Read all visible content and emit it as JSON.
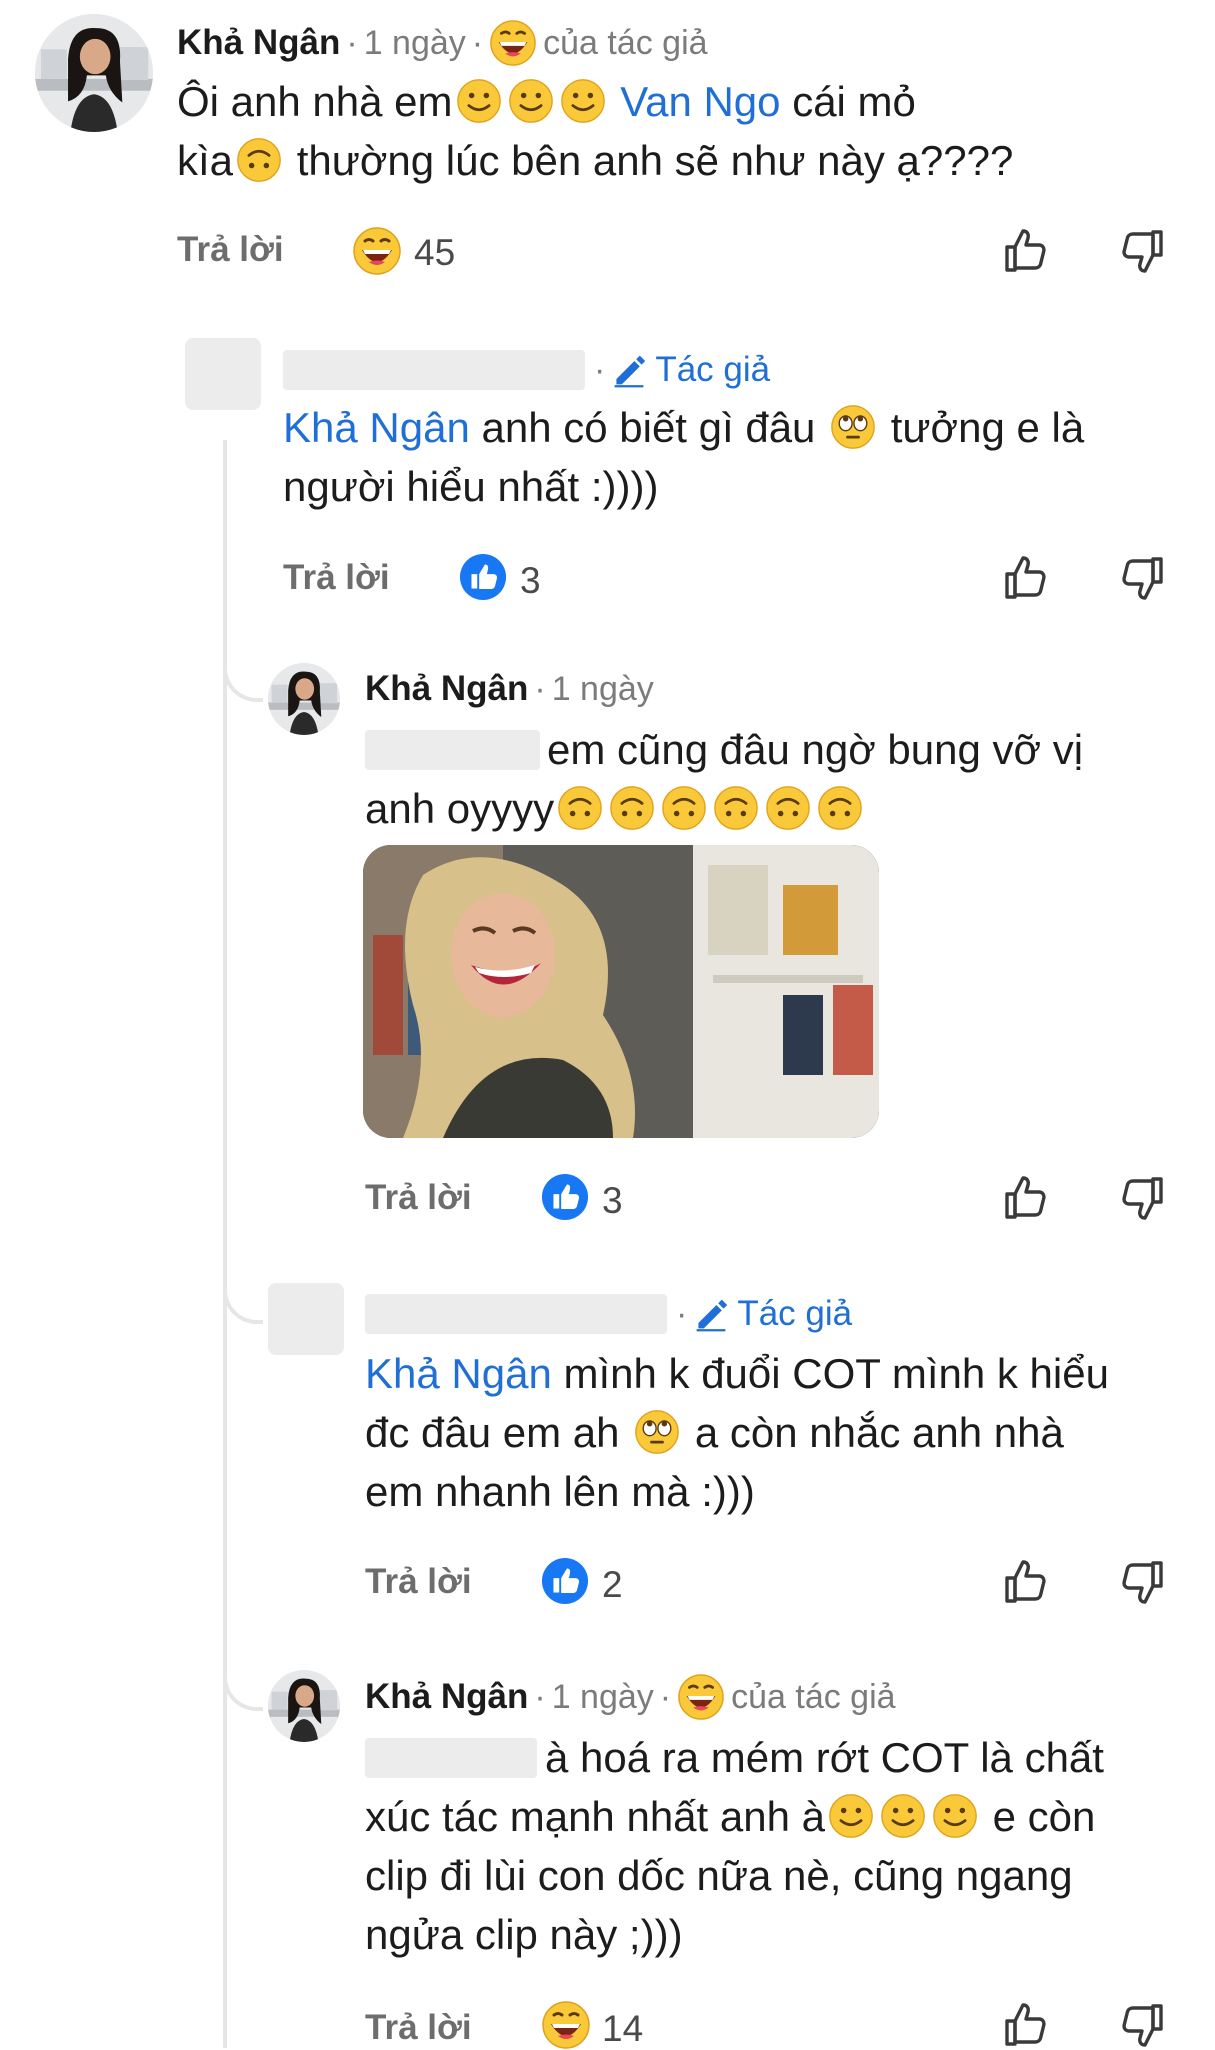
{
  "comments": [
    {
      "author": "Khả Ngân",
      "time": "1 ngày",
      "author_badge": "của tác giả",
      "text_1": "Ôi anh nhà em",
      "mention": "Van Ngo",
      "text_2": "cái mỏ",
      "text_3": "kìa",
      "text_4": "thường lúc bên anh sẽ như này ạ????",
      "reply_label": "Trả lời",
      "reaction_icon": "grin-emoji-icon",
      "reaction_count": "45"
    },
    {
      "author_tag": "Tác giả",
      "mention": "Khả Ngân",
      "text_1": "anh có biết gì đâu",
      "text_2": "tưởng e là",
      "text_3": "người hiểu nhất :))))",
      "reply_label": "Trả lời",
      "reaction_icon": "like-icon",
      "reaction_count": "3"
    },
    {
      "author": "Khả Ngân",
      "time": "1 ngày",
      "text_1": "em cũng đâu ngờ bung vỡ vị",
      "text_2": "anh oyyyy",
      "reply_label": "Trả lời",
      "reaction_icon": "like-icon",
      "reaction_count": "3"
    },
    {
      "author_tag": "Tác giả",
      "mention": "Khả Ngân",
      "text_1": "mình k đuổi COT mình k hiểu",
      "text_2": "đc đâu em ah",
      "text_3": "a còn nhắc anh nhà",
      "text_4": "em nhanh lên mà :)))",
      "reply_label": "Trả lời",
      "reaction_icon": "like-icon",
      "reaction_count": "2"
    },
    {
      "author": "Khả Ngân",
      "time": "1 ngày",
      "author_badge": "của tác giả",
      "text_1": "à hoá ra mém rớt COT là chất",
      "text_2": "xúc tác mạnh nhất anh à",
      "text_3": "e còn",
      "text_4": "clip đi lùi  con dốc nữa nè, cũng ngang",
      "text_5": "ngửa clip này ;)))",
      "reply_label": "Trả lời",
      "reaction_icon": "grin-emoji-icon",
      "reaction_count": "14"
    }
  ],
  "colors": {
    "mention": "#1f6fd6",
    "like_blue": "#1877f2",
    "emoji_yellow": "#f7c33a"
  }
}
